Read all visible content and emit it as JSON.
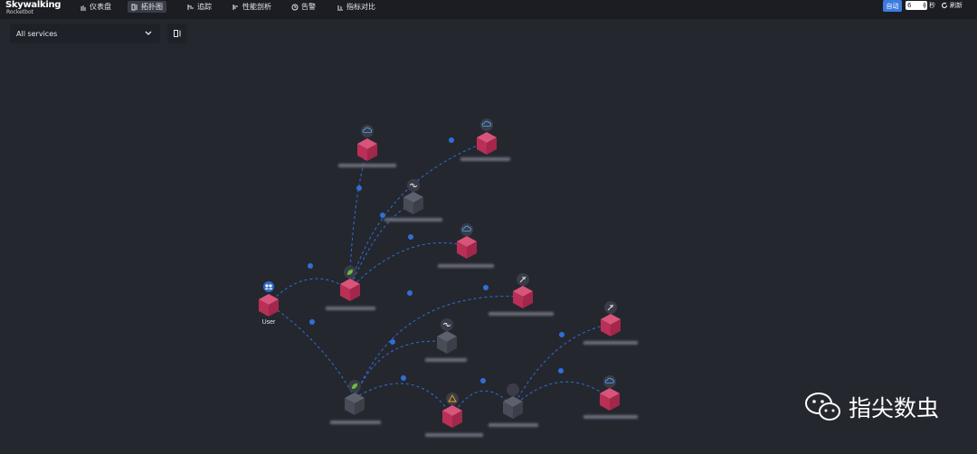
{
  "header": {
    "brand": "Skywalking",
    "brand_sub": "Rocketbot",
    "nav": [
      {
        "label": "仪表盘",
        "icon": "dashboard-icon"
      },
      {
        "label": "拓扑图",
        "icon": "topology-icon"
      },
      {
        "label": "追踪",
        "icon": "trace-icon"
      },
      {
        "label": "性能剖析",
        "icon": "profile-icon"
      },
      {
        "label": "告警",
        "icon": "alarm-icon"
      },
      {
        "label": "指标对比",
        "icon": "compare-icon"
      }
    ],
    "active_nav": "拓扑图",
    "auto_label": "自动",
    "interval_value": "6",
    "interval_unit": "秒",
    "refresh_label": "刷新"
  },
  "toolbar": {
    "service_select": "All services"
  },
  "topology": {
    "user_label": "User",
    "node_colors": {
      "service": "#c8385f",
      "middleware": "#4a4f5c"
    },
    "edge_color": "#2f6fd6"
  },
  "watermark": {
    "text": "指尖数虫"
  }
}
